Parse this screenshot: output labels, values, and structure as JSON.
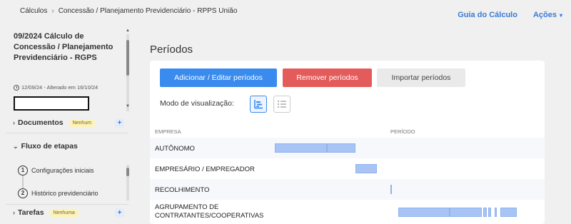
{
  "breadcrumb": [
    "Cálculos",
    "Concessão / Planejamento Previdenciário - RPPS União"
  ],
  "breadcrumb_sep": "›",
  "top_actions": {
    "guide": "Guia do Cálculo",
    "actions": "Ações",
    "actions_caret": "▾"
  },
  "calc": {
    "title": "09/2024 Cálculo de Concessão / Planejamento Previdenciário - RGPS",
    "meta": "12/09/24 - Alterado em 16/10/24"
  },
  "sidebar": {
    "documents": {
      "label": "Documentos",
      "badge": "Nenhum"
    },
    "flow": {
      "label": "Fluxo de etapas"
    },
    "steps": [
      {
        "num": "1",
        "label": "Configurações iniciais"
      },
      {
        "num": "2",
        "label": "Histórico previdenciário"
      }
    ],
    "tasks": {
      "label": "Tarefas",
      "badge": "Nenhuma"
    },
    "plus": "+",
    "chevron_right": "›",
    "chevron_down": "⌄"
  },
  "main": {
    "title": "Períodos",
    "buttons": {
      "add": "Adicionar / Editar períodos",
      "remove": "Remover períodos",
      "import": "Importar períodos"
    },
    "view_label": "Modo de visualização:",
    "table": {
      "headers": {
        "company": "EMPRESA",
        "period": "PERÍODO"
      },
      "rows": [
        {
          "name": "AUTÔNOMO"
        },
        {
          "name": "EMPRESÁRIO / EMPREGADOR"
        },
        {
          "name": "RECOLHIMENTO"
        },
        {
          "name": "AGRUPAMENTO DE CONTRATANTES/COOPERATIVAS"
        }
      ]
    }
  },
  "colors": {
    "accent": "#3a8bee",
    "danger": "#e35b5b",
    "bar": "#a7c4f5",
    "badge": "#fff3b0"
  }
}
